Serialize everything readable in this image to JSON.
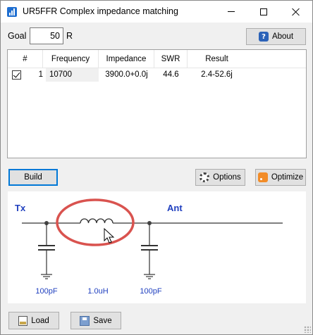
{
  "window": {
    "title": "UR5FFR Complex impedance matching",
    "minimize": "minimize",
    "maximize": "maximize",
    "close": "close"
  },
  "goal": {
    "label": "Goal",
    "value": "50",
    "unit": "R"
  },
  "toolbar": {
    "about_label": "About",
    "build_label": "Build",
    "options_label": "Options",
    "optimize_label": "Optimize",
    "load_label": "Load",
    "save_label": "Save"
  },
  "table": {
    "columns": [
      "#",
      "Frequency",
      "Impedance",
      "SWR",
      "Result"
    ],
    "rows": [
      {
        "checked": true,
        "index": "1",
        "frequency": "10700",
        "impedance": "3900.0+0.0j",
        "swr": "44.6",
        "result": "2.4-52.6j"
      }
    ]
  },
  "schematic": {
    "left_label": "Tx",
    "right_label": "Ant",
    "c1_value": "100pF",
    "l1_value": "1.0uH",
    "c2_value": "100pF",
    "highlight_color": "#d9534f",
    "label_color": "#1f3fbf"
  },
  "icons": {
    "app": "app-icon",
    "about": "help-icon",
    "options": "gear-icon",
    "optimize": "rss-icon",
    "load": "file-icon",
    "save": "save-icon",
    "cursor": "mouse-cursor-icon"
  }
}
